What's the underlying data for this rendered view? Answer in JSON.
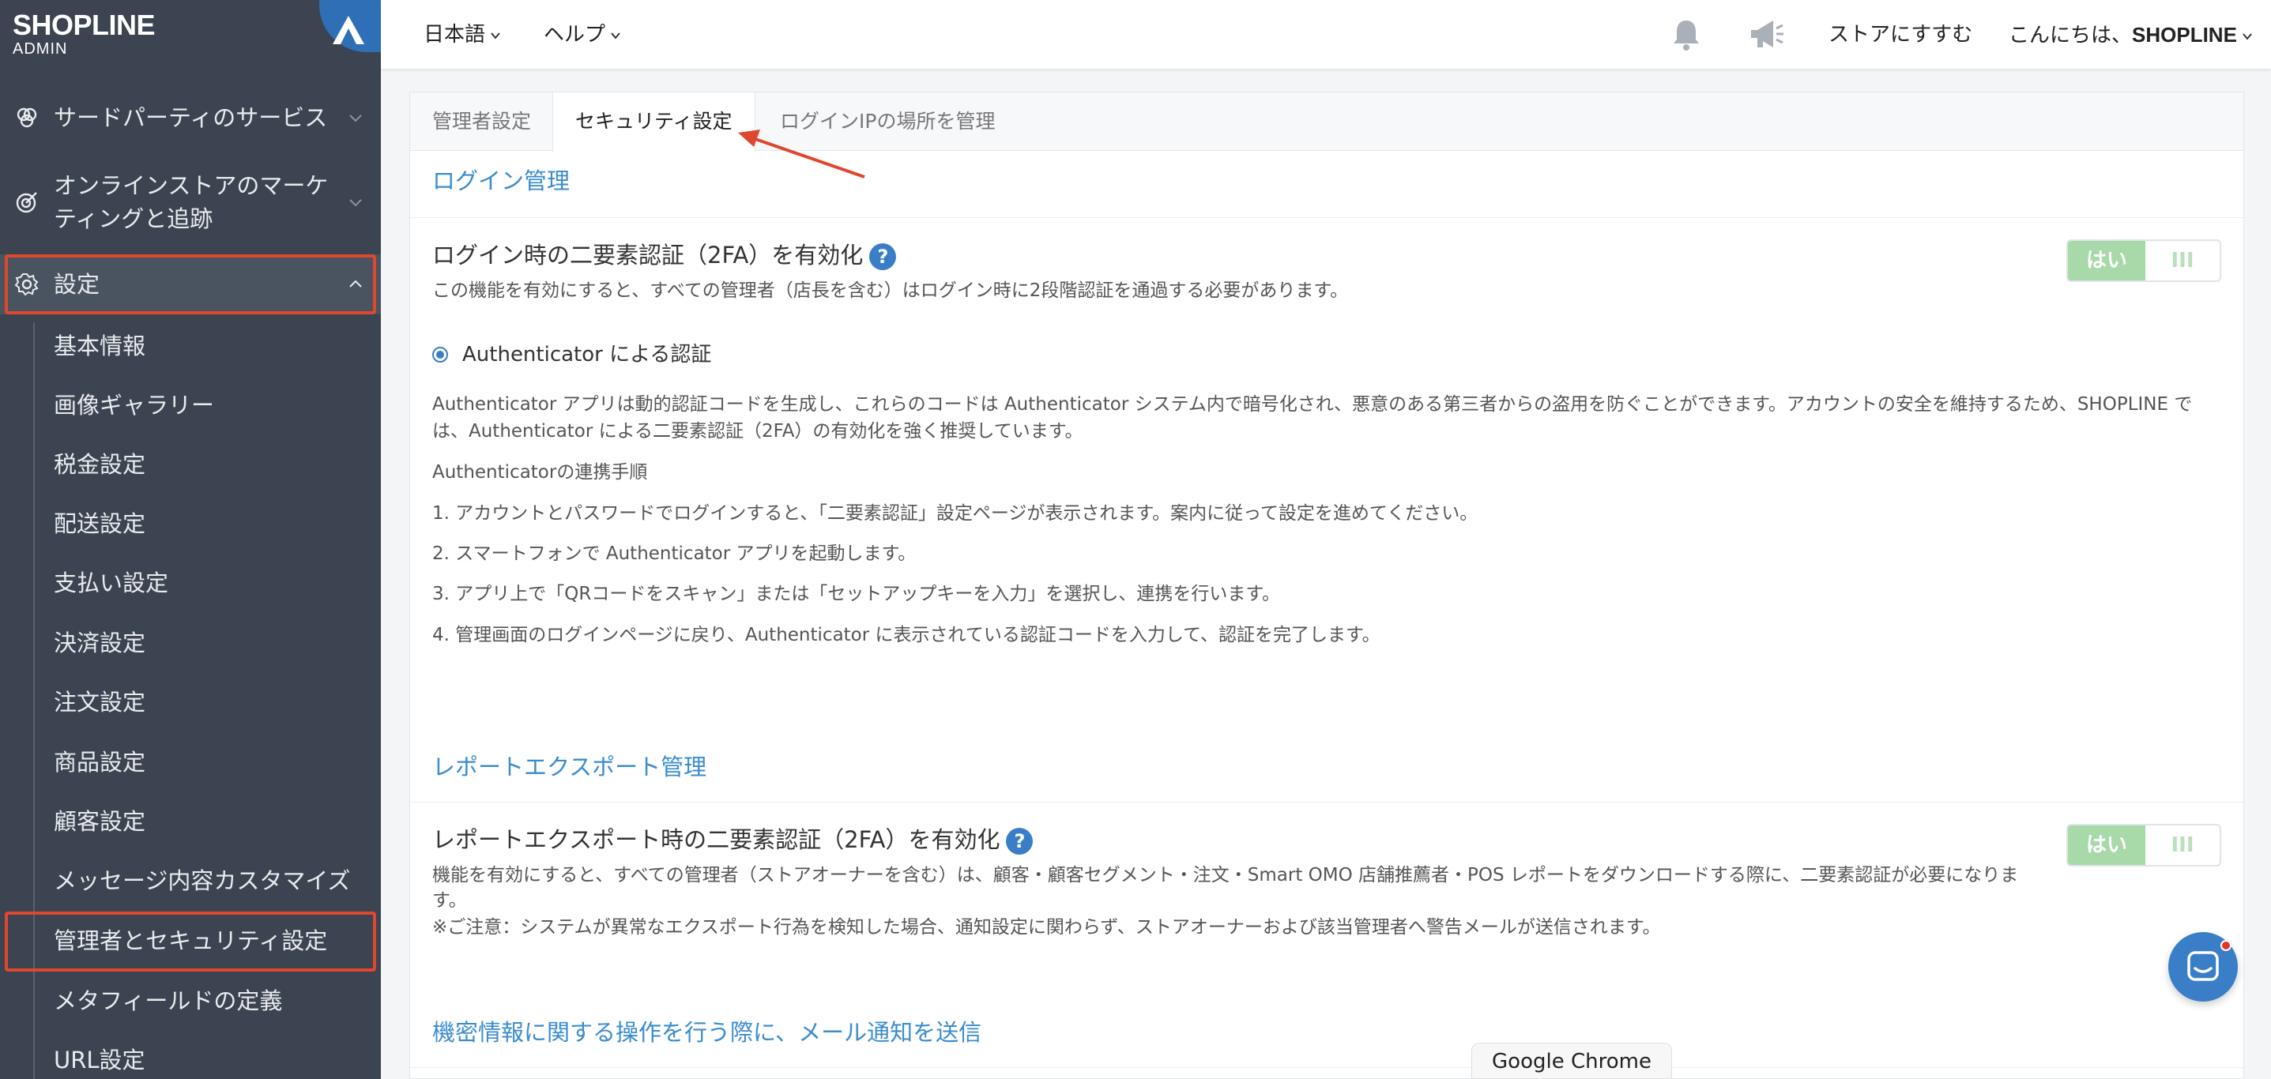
{
  "app": {
    "brand": "SHOPLINE",
    "brand_sub": "ADMIN"
  },
  "colors": {
    "sidebar_bg": "#3b4450",
    "accent": "#3a8ccf",
    "highlight": "#e0472f",
    "toggle_on": "#a7d9a9"
  },
  "sidebar": {
    "top_items": [
      {
        "label": "サードパーティのサービス",
        "icon": "third-party-icon"
      },
      {
        "label": "オンラインストアのマーケ",
        "label2": "ティングと追跡",
        "icon": "marketing-target-icon"
      },
      {
        "label": "設定",
        "icon": "gear-icon"
      }
    ],
    "sub_items": [
      "基本情報",
      "画像ギャラリー",
      "税金設定",
      "配送設定",
      "支払い設定",
      "決済設定",
      "注文設定",
      "商品設定",
      "顧客設定",
      "メッセージ内容カスタマイズ",
      "管理者とセキュリティ設定",
      "メタフィールドの定義",
      "URL設定"
    ]
  },
  "topbar": {
    "language": "日本語",
    "help": "ヘルプ",
    "store_link": "ストアにすすむ",
    "greeting": "こんにちは、",
    "user": "SHOPLINE"
  },
  "tabs": [
    {
      "label": "管理者設定",
      "active": false
    },
    {
      "label": "セキュリティ設定",
      "active": true
    },
    {
      "label": "ログインIPの場所を管理",
      "active": false
    }
  ],
  "login_section": {
    "title": "ログイン管理",
    "setting_title": "ログイン時の二要素認証（2FA）を有効化",
    "setting_desc": "この機能を有効にすると、すべての管理者（店長を含む）はログイン時に2段階認証を通過する必要があります。",
    "toggle_on": "はい",
    "toggle_off": "III",
    "radio_label": "Authenticator による認証",
    "body_line1": "Authenticator アプリは動的認証コードを生成し、これらのコードは Authenticator システム内で暗号化され、悪意のある第三者からの盗用を防ぐことができます。アカウントの安全を維持するため、SHOPLINE で",
    "body_line2": "は、Authenticator による二要素認証（2FA）の有効化を強く推奨しています。",
    "steps_title": "Authenticatorの連携手順",
    "steps": [
      "1. アカウントとパスワードでログインすると、「二要素認証」設定ページが表示されます。案内に従って設定を進めてください。",
      "2. スマートフォンで Authenticator アプリを起動します。",
      "3. アプリ上で「QRコードをスキャン」または「セットアップキーを入力」を選択し、連携を行います。",
      "4. 管理画面のログインページに戻り、Authenticator に表示されている認証コードを入力して、認証を完了します。"
    ]
  },
  "report_section": {
    "title": "レポートエクスポート管理",
    "setting_title": "レポートエクスポート時の二要素認証（2FA）を有効化",
    "desc_line1": "機能を有効にすると、すべての管理者（ストアオーナーを含む）は、顧客・顧客セグメント・注文・Smart OMO 店舗推薦者・POS レポートをダウンロードする際に、二要素認証が必要になりま",
    "desc_line2": "す。",
    "desc_line3": "※ご注意：システムが異常なエクスポート行為を検知した場合、通知設定に関わらず、ストアオーナーおよび該当管理者へ警告メールが送信されます。",
    "toggle_on": "はい",
    "toggle_off": "III"
  },
  "notify_section": {
    "title": "機密情報に関する操作を行う際に、メール通知を送信"
  },
  "tooltip": "Google Chrome"
}
